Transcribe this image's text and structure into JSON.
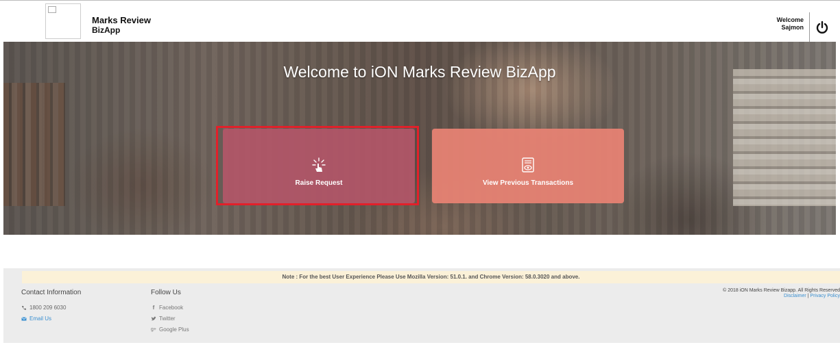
{
  "header": {
    "app_name_line1": "Marks Review",
    "app_name_line2": "BizApp",
    "welcome_label": "Welcome",
    "user_name": "Sajmon",
    "power_icon": "power-icon"
  },
  "hero": {
    "title": "Welcome to iON Marks Review BizApp",
    "tiles": [
      {
        "label": "Raise Request",
        "icon": "hand-tap-icon",
        "color": "#b25668"
      },
      {
        "label": "View Previous Transactions",
        "icon": "document-view-icon",
        "color": "#e68273"
      }
    ],
    "highlight_color": "#e2202a"
  },
  "footer": {
    "note": "Note : For the best User Experience Please Use Mozilla Version: 51.0.1. and Chrome Version: 58.0.3020 and above.",
    "contact": {
      "title": "Contact Information",
      "phone": "1800 209 6030",
      "email_label": "Email Us"
    },
    "follow": {
      "title": "Follow Us",
      "items": [
        "Facebook",
        "Twitter",
        "Google Plus"
      ]
    },
    "copyright": "© 2018 iON Marks Review Bizapp. All Rights Reserved",
    "disclaimer": "Disclaimer",
    "separator": "|",
    "privacy": "Privacy Policy"
  }
}
